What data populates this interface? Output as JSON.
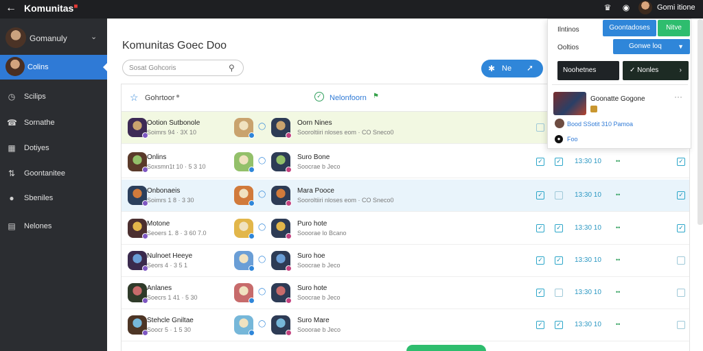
{
  "topbar": {
    "back_icon": "arrow-left-icon",
    "title": "Komunitas",
    "user_name": "Gomi itione"
  },
  "sidebar": {
    "profile_name": "Gomanuly",
    "items": [
      {
        "label": "Colins",
        "icon": "avatar",
        "active": true
      },
      {
        "label": "Scilips",
        "icon": "clock-icon"
      },
      {
        "label": "Sornathe",
        "icon": "compass-icon"
      },
      {
        "label": "Dotiyes",
        "icon": "grid-icon"
      },
      {
        "label": "Goontanitee",
        "icon": "sliders-icon"
      },
      {
        "label": "Sbeniles",
        "icon": "paw-icon"
      },
      {
        "label": "Nelones",
        "icon": "list-icon"
      }
    ]
  },
  "main": {
    "title": "Komunitas Goec Doo",
    "search_text": "Sosat Gohcoris",
    "action_label": "Ne"
  },
  "list": {
    "header_left": "Gohrtoor",
    "header_right": "Nelonfoorn",
    "rows": [
      {
        "name1": "Ootion Sutbonole",
        "sub1": "Soimrs 94 · 3X 10",
        "name2": "Oorn Nines",
        "sub2": "Sooroltiiri nloses eom · CO Sneco0",
        "cb1": false,
        "cb2": null,
        "time": "",
        "dots": ""
      },
      {
        "name1": "Onlins",
        "sub1": "Soxsmn1t 10 · 5 3 10",
        "name2": "Suro Bone",
        "sub2": "Soocrae b Jeco",
        "cb1": true,
        "cb2": true,
        "time": "13:30 10",
        "dots": "••"
      },
      {
        "name1": "Onbonaeis",
        "sub1": "Soimrs 1 8 · 3 30",
        "name2": "Mara Pooce",
        "sub2": "Sooroltiiri nloses eom · CO Sneco0",
        "cb1": true,
        "cb2": false,
        "time": "13:30 10",
        "dots": "••"
      },
      {
        "name1": "Motone",
        "sub1": "Seoers 1. 8 · 3 60 7.0",
        "name2": "Puro hote",
        "sub2": "Sooorae lo Bcano",
        "cb1": true,
        "cb2": true,
        "time": "13:30 10",
        "dots": "••"
      },
      {
        "name1": "Nulnoet Heeye",
        "sub1": "Seors 4 · 3 5 1",
        "name2": "Suro hoe",
        "sub2": "Soocrae b Jeco",
        "cb1": true,
        "cb2": true,
        "time": "13:30 10",
        "dots": "••"
      },
      {
        "name1": "Anlanes",
        "sub1": "Soecrs 1 41 · 5 30",
        "name2": "Suro hote",
        "sub2": "Soocrae b Jeco",
        "cb1": true,
        "cb2": false,
        "time": "13:30 10",
        "dots": "••"
      },
      {
        "name1": "Stehcle Gniltae",
        "sub1": "Soocr 5 · 1 5 30",
        "name2": "Suro Mare",
        "sub2": "Sooorae b Jeco",
        "cb1": true,
        "cb2": true,
        "time": "13:30 10",
        "dots": "••"
      }
    ],
    "row_checks_right": [
      false,
      true,
      true,
      true,
      false,
      false,
      false
    ]
  },
  "panel": {
    "label1": "Ilntinos",
    "btn_blue": "Goontadoses",
    "btn_green": "Nitve",
    "label2": "Ooltios",
    "select_value": "Gonwe loq",
    "btn_dark1": "Noohetnes",
    "btn_dark2": "Nonles",
    "card_title": "Goonatte Gogone",
    "card_meta": "Bood SSotit 310 Pamoa",
    "foot": "Foo"
  },
  "colors": {
    "sidebar_bg": "#2b2d31",
    "active": "#2f7ad6",
    "accent_green": "#2ebd6e",
    "topbar_bg": "#1e1f22"
  }
}
